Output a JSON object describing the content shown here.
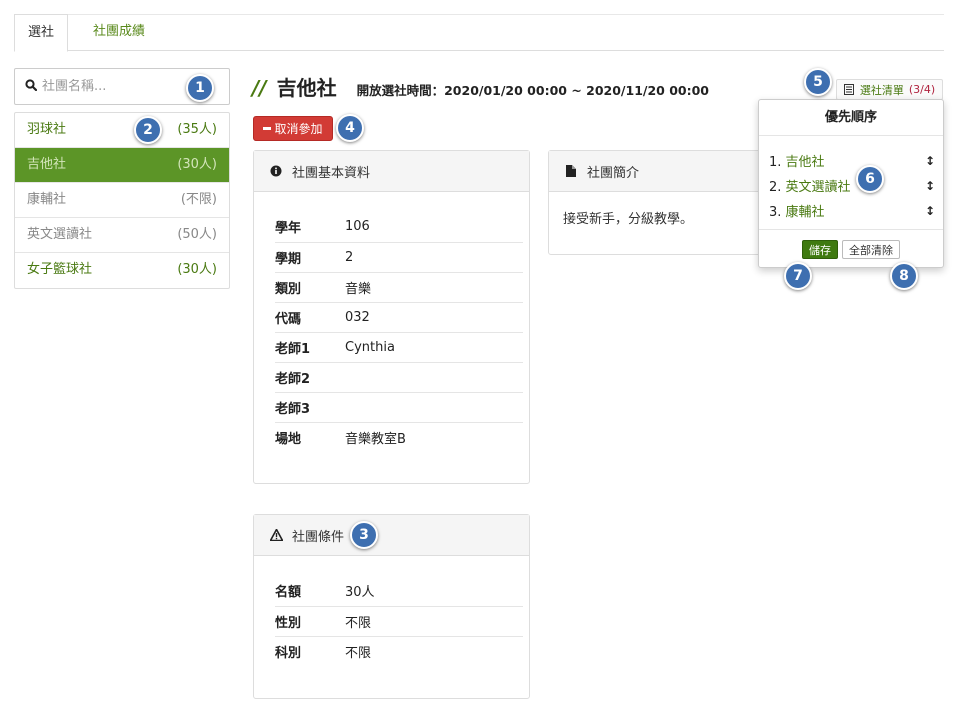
{
  "tabs": [
    {
      "label": "選社",
      "active": true
    },
    {
      "label": "社團成績",
      "active": false
    }
  ],
  "search": {
    "placeholder": "社團名稱...",
    "icon": "search-icon"
  },
  "clubs": [
    {
      "name": "羽球社",
      "quota": "(35人)",
      "state": "green"
    },
    {
      "name": "吉他社",
      "quota": "(30人)",
      "state": "active"
    },
    {
      "name": "康輔社",
      "quota": "(不限)",
      "state": "grey"
    },
    {
      "name": "英文選讀社",
      "quota": "(50人)",
      "state": "grey"
    },
    {
      "name": "女子籃球社",
      "quota": "(30人)",
      "state": "green"
    }
  ],
  "header": {
    "slashes": "//",
    "club_name": "吉他社",
    "open_time": "開放選社時間：2020/01/20 00:00 ~ 2020/11/20 00:00"
  },
  "cancel_button": "取消參加",
  "info_panel": {
    "title": "社團基本資料",
    "icon": "info-icon",
    "rows": [
      {
        "k": "學年",
        "v": "106"
      },
      {
        "k": "學期",
        "v": "2"
      },
      {
        "k": "類別",
        "v": "音樂"
      },
      {
        "k": "代碼",
        "v": "032"
      },
      {
        "k": "老師1",
        "v": "Cynthia"
      },
      {
        "k": "老師2",
        "v": ""
      },
      {
        "k": "老師3",
        "v": ""
      },
      {
        "k": "場地",
        "v": "音樂教室B"
      }
    ]
  },
  "intro_panel": {
    "title": "社團簡介",
    "icon": "document-icon",
    "text": "接受新手，分級教學。"
  },
  "cond_panel": {
    "title": "社團條件",
    "icon": "warning-icon",
    "rows": [
      {
        "k": "名額",
        "v": "30人"
      },
      {
        "k": "性別",
        "v": "不限"
      },
      {
        "k": "科別",
        "v": "不限"
      }
    ]
  },
  "list_button": {
    "label": "選社清單",
    "count": "(3/4)",
    "icon": "list-icon"
  },
  "popover": {
    "title": "優先順序",
    "items": [
      {
        "num": "1.",
        "name": "吉他社"
      },
      {
        "num": "2.",
        "name": "英文選讀社"
      },
      {
        "num": "3.",
        "name": "康輔社"
      }
    ],
    "drag_glyph": "↕",
    "save": "儲存",
    "clear": "全部清除"
  },
  "markers": [
    "1",
    "2",
    "3",
    "4",
    "5",
    "6",
    "7",
    "8"
  ],
  "colors": {
    "accent_green": "#4b8a10",
    "danger": "#d23b35",
    "marker_blue": "#3e6fb0",
    "count_red": "#b0233f"
  }
}
